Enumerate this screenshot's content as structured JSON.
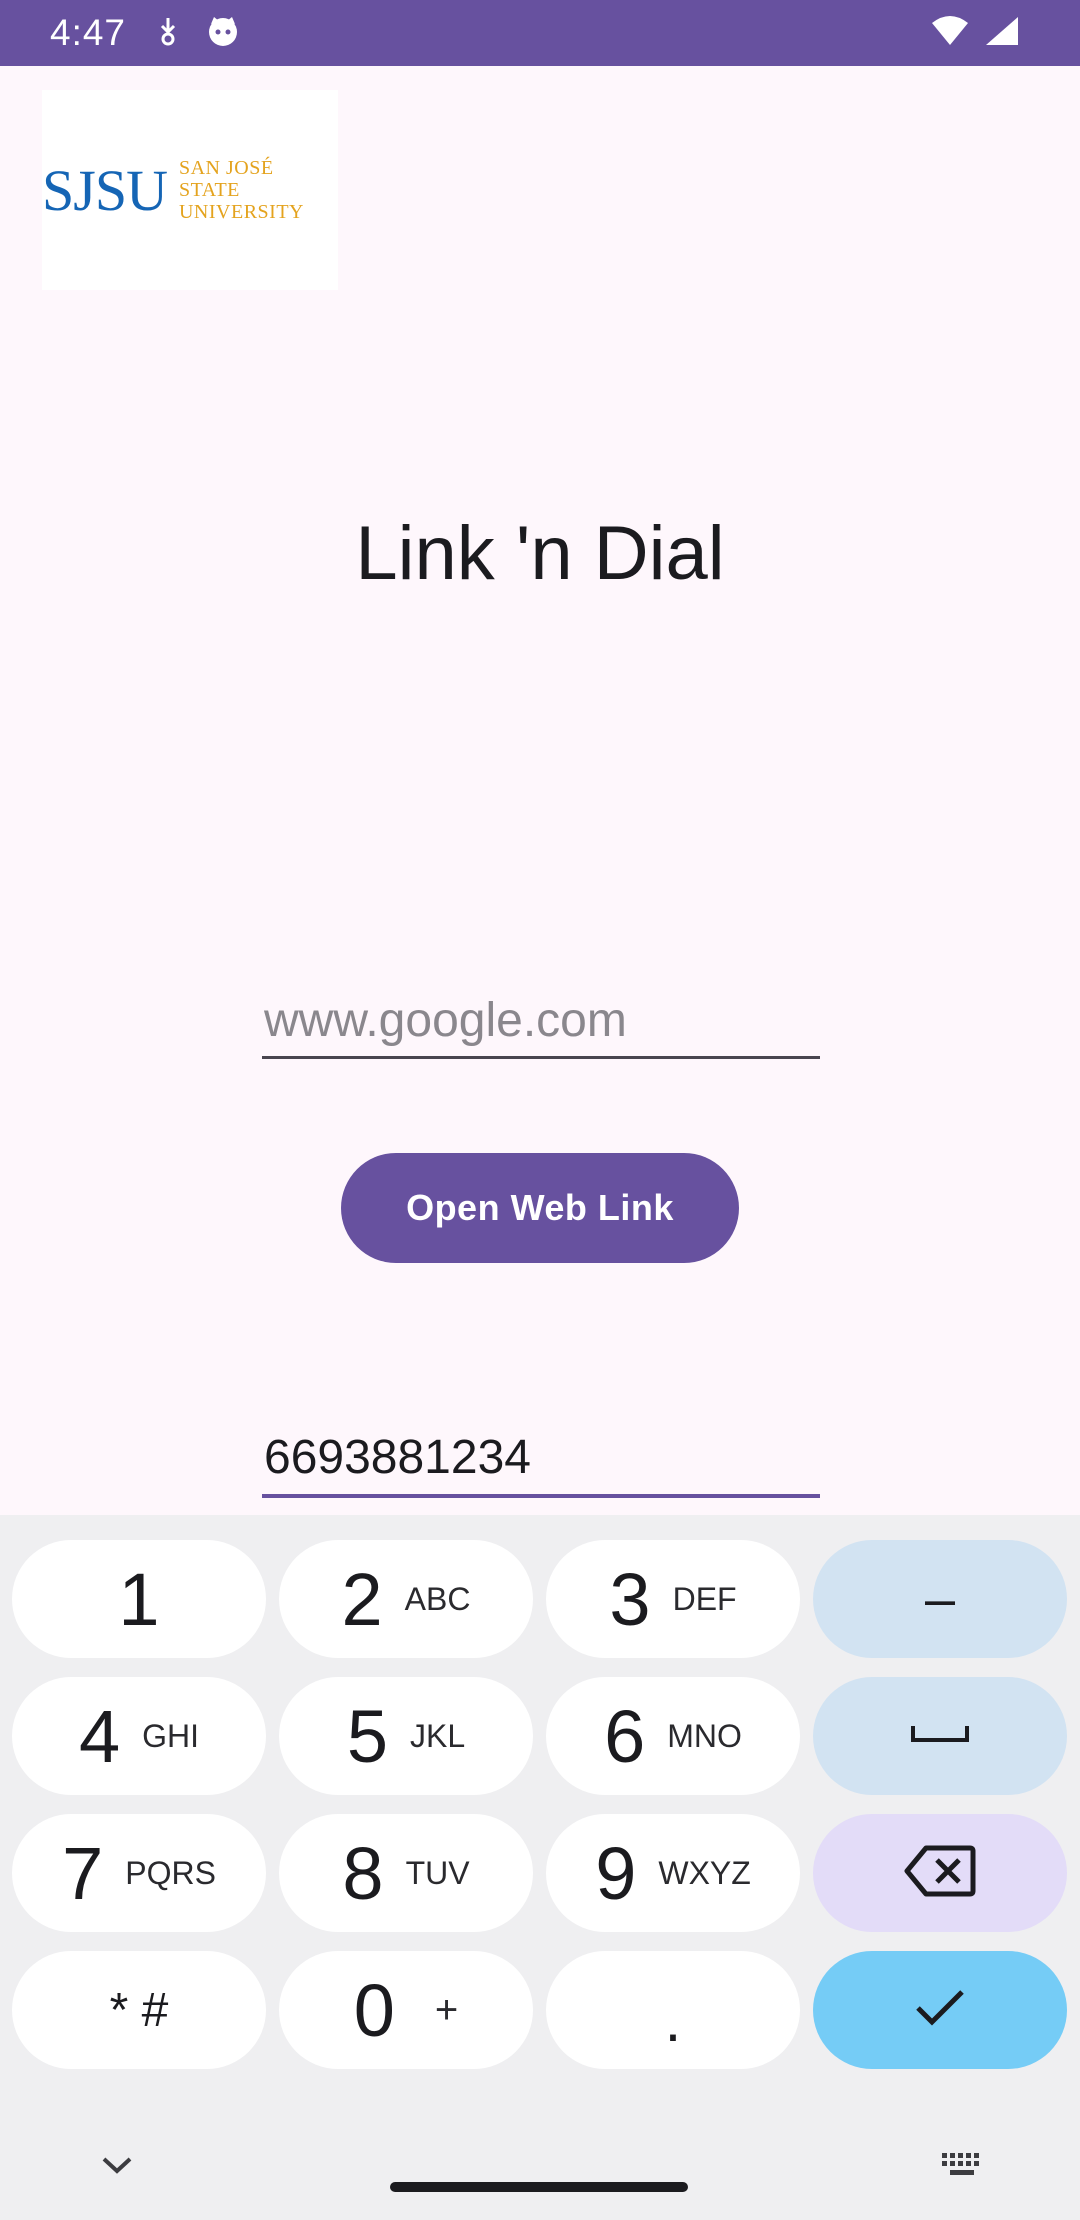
{
  "status_bar": {
    "time": "4:47"
  },
  "logo": {
    "mark": "SJSU",
    "line1": "SAN JOSÉ STATE",
    "line2": "UNIVERSITY"
  },
  "title": "Link 'n Dial",
  "url_input": {
    "placeholder": "www.google.com",
    "value": ""
  },
  "open_button": {
    "label": "Open Web Link"
  },
  "phone_input": {
    "value": "6693881234"
  },
  "keyboard": {
    "keys": [
      {
        "digit": "1",
        "letters": ""
      },
      {
        "digit": "2",
        "letters": "ABC"
      },
      {
        "digit": "3",
        "letters": "DEF"
      },
      {
        "digit": "4",
        "letters": "GHI"
      },
      {
        "digit": "5",
        "letters": "JKL"
      },
      {
        "digit": "6",
        "letters": "MNO"
      },
      {
        "digit": "7",
        "letters": "PQRS"
      },
      {
        "digit": "8",
        "letters": "TUV"
      },
      {
        "digit": "9",
        "letters": "WXYZ"
      },
      {
        "digit": "* #",
        "letters": ""
      },
      {
        "digit": "0",
        "letters": "+"
      },
      {
        "digit": ".",
        "letters": ""
      }
    ],
    "dash": "–"
  },
  "colors": {
    "primary": "#67519f",
    "background": "#fef7fc",
    "keyboard": "#efeff1",
    "fn_key": "#d2e3f2",
    "delete_key": "#e3dcf8",
    "ok_key": "#75ccf6"
  }
}
